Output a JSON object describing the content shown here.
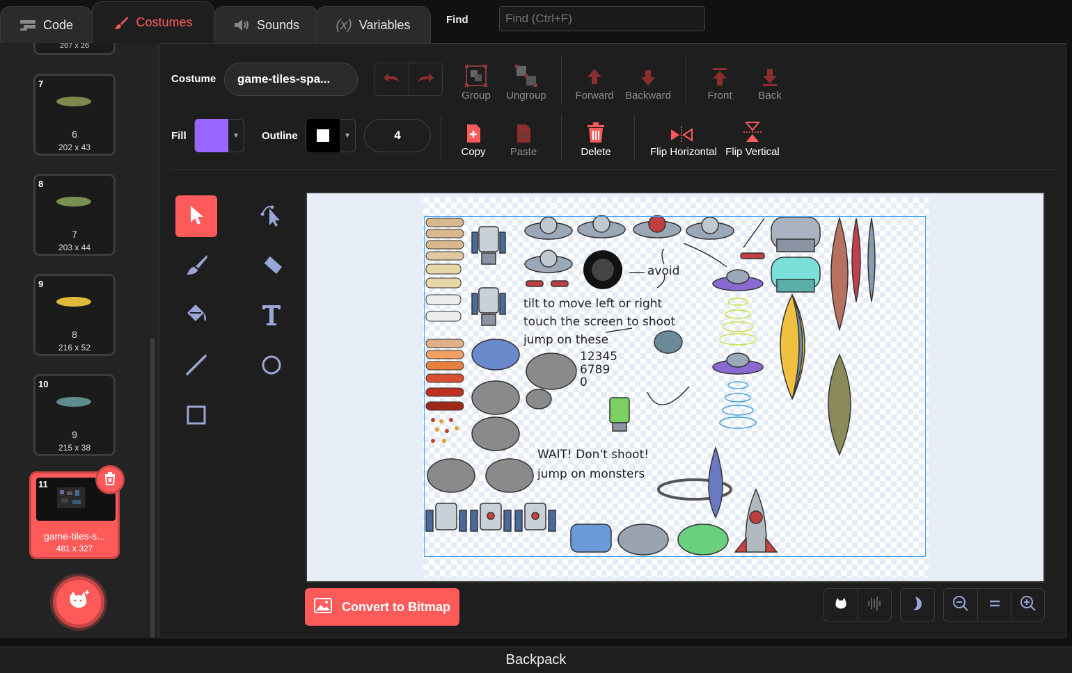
{
  "tabs": [
    {
      "label": "Code",
      "icon": "code-icon",
      "active": false
    },
    {
      "label": "Costumes",
      "icon": "brush-icon",
      "active": true
    },
    {
      "label": "Sounds",
      "icon": "speaker-icon",
      "active": false
    },
    {
      "label": "Variables",
      "icon": "variables-icon",
      "active": false
    }
  ],
  "find": {
    "label": "Find",
    "placeholder": "Find (Ctrl+F)"
  },
  "costumes": {
    "partial_top_size": "267 x 26",
    "items": [
      {
        "number": "7",
        "name": "6",
        "size": "202 x 43",
        "color": "#7d8a4c"
      },
      {
        "number": "8",
        "name": "7",
        "size": "203 x 44",
        "color": "#7a8f52"
      },
      {
        "number": "9",
        "name": "8",
        "size": "216 x 52",
        "color": "#e0b83a"
      },
      {
        "number": "10",
        "name": "9",
        "size": "215 x 38",
        "color": "#5f8c8c"
      }
    ],
    "selected": {
      "number": "11",
      "name": "game-tiles-s...",
      "size": "481 x 327"
    }
  },
  "toolbar": {
    "costume_label": "Costume",
    "costume_name": "game-tiles-spa...",
    "fill_label": "Fill",
    "fill_color": "#9966ff",
    "outline_label": "Outline",
    "outline_color": "#000000",
    "outline_width": "4",
    "group": "Group",
    "ungroup": "Ungroup",
    "forward": "Forward",
    "backward": "Backward",
    "front": "Front",
    "back": "Back",
    "copy": "Copy",
    "paste": "Paste",
    "delete": "Delete",
    "flip_horizontal": "Flip Horizontal",
    "flip_vertical": "Flip Vertical"
  },
  "canvas_text": {
    "avoid": "avoid",
    "tilt": "tilt to move left or right",
    "touch": "touch the screen to shoot",
    "jump": "jump on these",
    "digits1": "12345",
    "digits2": "6789",
    "digits3": "0",
    "wait": "WAIT! Don't shoot!",
    "jump_monsters": "jump on monsters"
  },
  "convert_button": "Convert to Bitmap",
  "backpack": "Backpack",
  "colors": {
    "accent": "#ff5a5a",
    "selection": "#3aa0ff"
  }
}
